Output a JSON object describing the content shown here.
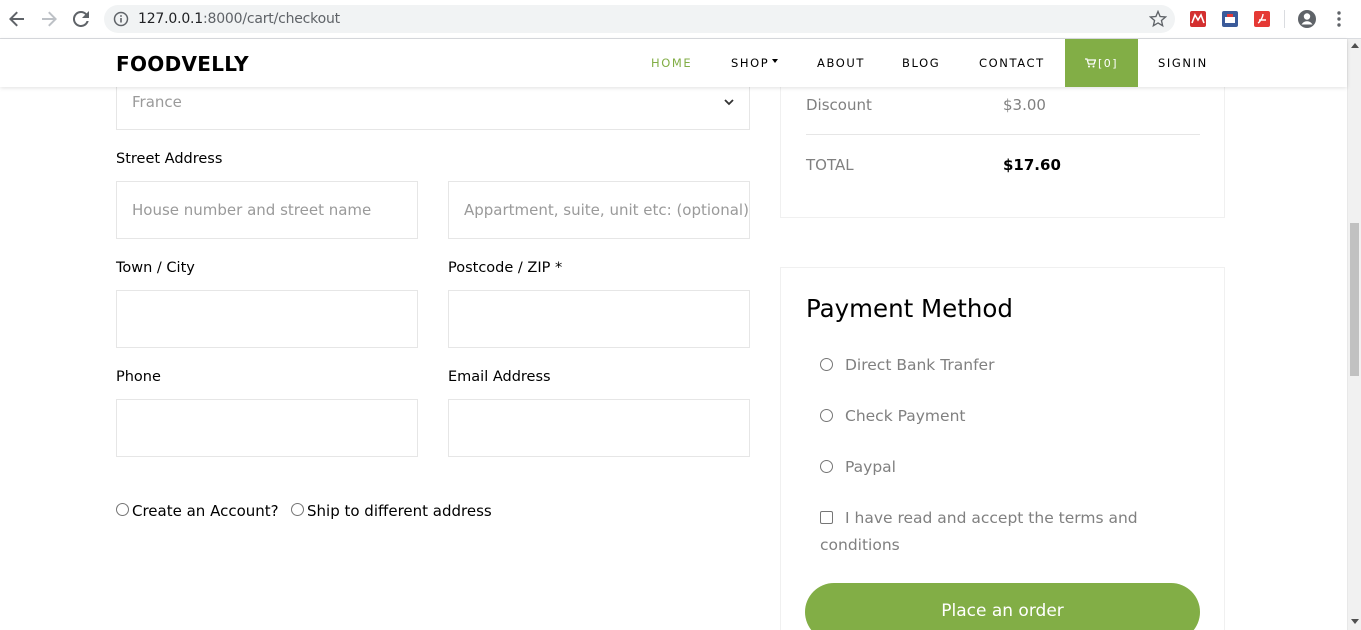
{
  "browser": {
    "url_host": "127.0.0.1",
    "url_rest": ":8000/cart/checkout"
  },
  "header": {
    "brand": "FOODVELLY",
    "nav": {
      "home": "HOME",
      "shop": "SHOP",
      "about": "ABOUT",
      "blog": "BLOG",
      "contact": "CONTACT",
      "cart": "[0]",
      "signin": "SIGNIN"
    },
    "accent_color": "#82ae46"
  },
  "billing": {
    "country_value": "France",
    "street_label": "Street Address",
    "street_placeholder": "House number and street name",
    "apartment_placeholder": "Appartment, suite, unit etc: (optional)",
    "town_label": "Town / City",
    "postcode_label": "Postcode / ZIP *",
    "phone_label": "Phone",
    "email_label": "Email Address",
    "create_account": "Create an Account?",
    "ship_different": "Ship to different address"
  },
  "summary": {
    "discount_label": "Discount",
    "discount_value": "$3.00",
    "total_label": "TOTAL",
    "total_value": "$17.60"
  },
  "payment": {
    "title": "Payment Method",
    "options": [
      "Direct Bank Tranfer",
      "Check Payment",
      "Paypal"
    ],
    "terms": "I have read and accept the terms and",
    "terms_cont": "conditions",
    "place_order": "Place an order"
  }
}
